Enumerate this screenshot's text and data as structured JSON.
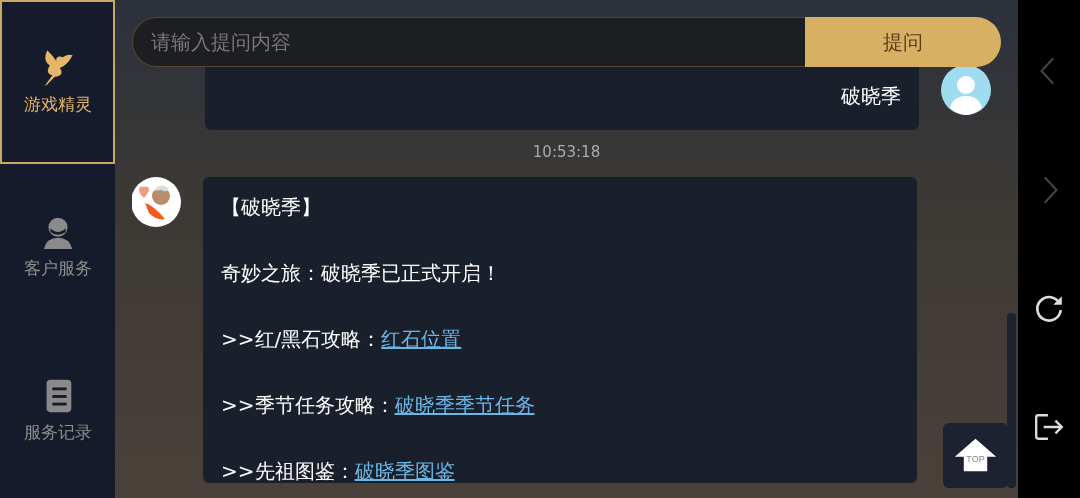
{
  "sidebar": {
    "items": [
      {
        "label": "游戏精灵",
        "kind": "fairy",
        "selected": true
      },
      {
        "label": "客户服务",
        "kind": "agent",
        "selected": false
      },
      {
        "label": "服务记录",
        "kind": "notebook",
        "selected": false
      }
    ]
  },
  "question": {
    "placeholder": "请输入提问内容",
    "button": "提问"
  },
  "messages": [
    {
      "kind": "user",
      "lines": [
        {
          "text": "破晓季"
        }
      ]
    },
    {
      "kind": "time",
      "text": "10:53:18"
    },
    {
      "kind": "bot",
      "lines": [
        {
          "text": "【破晓季】"
        },
        {
          "text": "奇妙之旅：破晓季已正式开启！"
        },
        {
          "text": ">>红/黑石攻略：",
          "link": "红石位置"
        },
        {
          "text": ">>季节任务攻略：",
          "link": "破晓季季节任务"
        },
        {
          "text": ">>先祖图鉴：",
          "link": "破晓季图鉴"
        }
      ]
    }
  ],
  "top_button": {
    "label": "TOP"
  }
}
